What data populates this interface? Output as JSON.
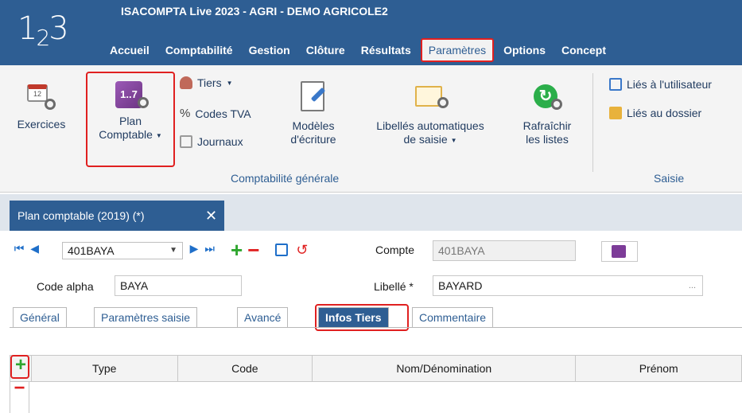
{
  "app": {
    "logo_main": "1",
    "logo_sub": "2",
    "logo_end": "3",
    "title": "ISACOMPTA Live 2023 - AGRI - DEMO AGRICOLE2"
  },
  "menu": [
    "Accueil",
    "Comptabilité",
    "Gestion",
    "Clôture",
    "Résultats",
    "Paramètres",
    "Options",
    "Concept"
  ],
  "ribbon": {
    "exercices": "Exercices",
    "plan_line1": "Plan",
    "plan_line2": "Comptable",
    "plan_icon_text": "1..7",
    "cal_text": "12",
    "tiers": "Tiers",
    "codes_tva": "Codes TVA",
    "journaux": "Journaux",
    "modeles_line1": "Modèles",
    "modeles_line2": "d'écriture",
    "libelles_line1": "Libellés automatiques",
    "libelles_line2": "de saisie",
    "rafraichir_line1": "Rafraîchir",
    "rafraichir_line2": "les listes",
    "lies_utilisateur": "Liés à l'utilisateur",
    "lies_dossier": "Liés au dossier",
    "group_compta": "Comptabilité générale",
    "group_saisie": "Saisie"
  },
  "doc_tab": {
    "label": "Plan comptable (2019) (*)",
    "close": "✕"
  },
  "toolbar": {
    "account_combo": "401BAYA",
    "compte_label": "Compte",
    "compte_value": "401BAYA",
    "code_alpha_label": "Code alpha",
    "code_alpha_value": "BAYA",
    "libelle_label": "Libellé *",
    "libelle_value": "BAYARD",
    "ellipsis": "..."
  },
  "inner_tabs": [
    "Général",
    "Paramètres saisie",
    "Avancé",
    "Infos Tiers",
    "Commentaire"
  ],
  "inner_tab_selected": "Infos Tiers",
  "grid": {
    "columns": [
      "Type",
      "Code",
      "Nom/Dénomination",
      "Prénom"
    ],
    "add_symbol": "+",
    "remove_symbol": "−"
  },
  "colors": {
    "brand_blue": "#2e5e93",
    "highlight_red": "#e02020",
    "add_green": "#2ea62e"
  }
}
